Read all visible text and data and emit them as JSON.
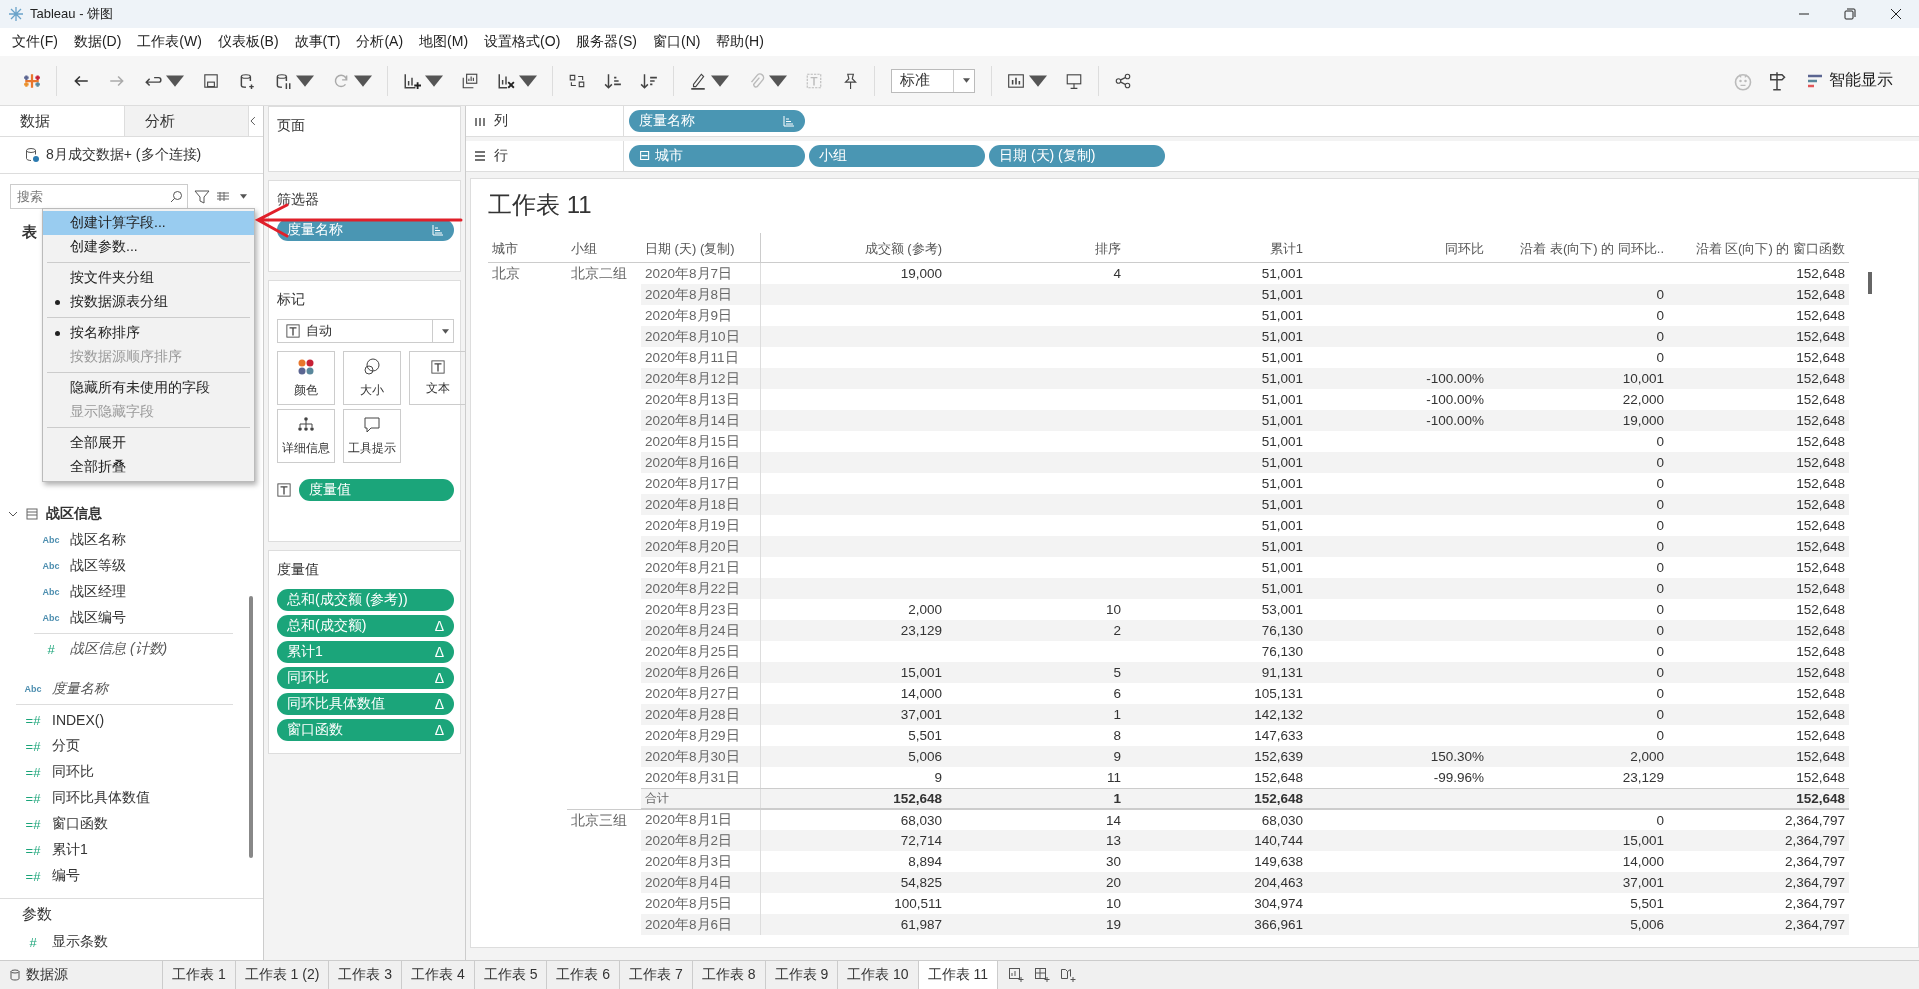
{
  "window": {
    "title": "Tableau - 饼图"
  },
  "menu_bar": [
    "文件(F)",
    "数据(D)",
    "工作表(W)",
    "仪表板(B)",
    "故事(T)",
    "分析(A)",
    "地图(M)",
    "设置格式(O)",
    "服务器(S)",
    "窗口(N)",
    "帮助(H)"
  ],
  "toolbar": {
    "view_size": "标准",
    "show_me": "智能显示"
  },
  "data_pane": {
    "tabs": [
      {
        "label": "数据",
        "selected": true
      },
      {
        "label": "分析",
        "selected": false
      }
    ],
    "data_source": "8月成交数据+ (多个连接)",
    "search": {
      "placeholder": "搜索"
    },
    "tables_heading": "表",
    "groups": [
      {
        "name": "战区信息",
        "expanded": true,
        "fields": [
          {
            "name": "战区名称",
            "icon": "Abc",
            "kind": "dimension"
          },
          {
            "name": "战区等级",
            "icon": "Abc",
            "kind": "dimension"
          },
          {
            "name": "战区经理",
            "icon": "Abc",
            "kind": "dimension"
          },
          {
            "name": "战区编号",
            "icon": "Abc",
            "kind": "dimension"
          },
          {
            "name": "战区信息 (计数)",
            "icon": "#",
            "kind": "generated_measure"
          }
        ]
      }
    ],
    "fields": [
      {
        "name": "度量名称",
        "icon": "Abc",
        "kind": "generated_dimension"
      },
      {
        "name": "INDEX()",
        "icon": "=#",
        "kind": "calc_measure"
      },
      {
        "name": "分页",
        "icon": "=#",
        "kind": "calc_measure"
      },
      {
        "name": "同环比",
        "icon": "=#",
        "kind": "calc_measure"
      },
      {
        "name": "同环比具体数值",
        "icon": "=#",
        "kind": "calc_measure"
      },
      {
        "name": "窗口函数",
        "icon": "=#",
        "kind": "calc_measure"
      },
      {
        "name": "累计1",
        "icon": "=#",
        "kind": "calc_measure"
      },
      {
        "name": "编号",
        "icon": "=#",
        "kind": "calc_measure"
      }
    ],
    "parameters_heading": "参数",
    "parameters": [
      {
        "name": "显示条数",
        "icon": "#"
      }
    ]
  },
  "context_menu": [
    {
      "kind": "item",
      "label": "创建计算字段...",
      "selected": true,
      "checked": false,
      "disabled": false
    },
    {
      "kind": "item",
      "label": "创建参数...",
      "selected": false,
      "checked": false,
      "disabled": false
    },
    {
      "kind": "separator"
    },
    {
      "kind": "item",
      "label": "按文件夹分组",
      "selected": false,
      "checked": false,
      "disabled": false
    },
    {
      "kind": "item",
      "label": "按数据源表分组",
      "selected": false,
      "checked": true,
      "disabled": false
    },
    {
      "kind": "separator"
    },
    {
      "kind": "item",
      "label": "按名称排序",
      "selected": false,
      "checked": true,
      "disabled": false
    },
    {
      "kind": "item",
      "label": "按数据源顺序排序",
      "selected": false,
      "checked": false,
      "disabled": true
    },
    {
      "kind": "separator"
    },
    {
      "kind": "item",
      "label": "隐藏所有未使用的字段",
      "selected": false,
      "checked": false,
      "disabled": false
    },
    {
      "kind": "item",
      "label": "显示隐藏字段",
      "selected": false,
      "checked": false,
      "disabled": true
    },
    {
      "kind": "separator"
    },
    {
      "kind": "item",
      "label": "全部展开",
      "selected": false,
      "checked": false,
      "disabled": false
    },
    {
      "kind": "item",
      "label": "全部折叠",
      "selected": false,
      "checked": false,
      "disabled": false
    }
  ],
  "pages_card": {
    "title": "页面"
  },
  "filters_card": {
    "title": "筛选器",
    "pills": [
      {
        "label": "度量名称",
        "kind": "dimension"
      }
    ]
  },
  "marks_card": {
    "title": "标记",
    "mark_type": "自动",
    "buttons": [
      {
        "label": "颜色",
        "kind": "color"
      },
      {
        "label": "大小",
        "kind": "size"
      },
      {
        "label": "文本",
        "kind": "text"
      },
      {
        "label": "详细信息",
        "kind": "detail"
      },
      {
        "label": "工具提示",
        "kind": "tooltip"
      }
    ],
    "pills": [
      {
        "label": "度量值",
        "kind": "text"
      }
    ]
  },
  "measure_values_card": {
    "title": "度量值",
    "pills": [
      {
        "label": "总和(成交额 (参考))"
      },
      {
        "label": "总和(成交额)",
        "flag": "Δ"
      },
      {
        "label": "累计1",
        "flag": "Δ"
      },
      {
        "label": "同环比",
        "flag": "Δ"
      },
      {
        "label": "同环比具体数值",
        "flag": "Δ"
      },
      {
        "label": "窗口函数",
        "flag": "Δ"
      }
    ]
  },
  "shelves": [
    {
      "kind": "columns",
      "label": "列",
      "pills": [
        {
          "label": "度量名称",
          "kind": "sorted"
        }
      ]
    },
    {
      "kind": "rows",
      "label": "行",
      "pills": [
        {
          "label": "城市",
          "prefix": "⊟",
          "kind": "plain"
        },
        {
          "label": "小组",
          "kind": "plain"
        },
        {
          "label": "日期 (天) (复制)",
          "kind": "plain"
        }
      ]
    }
  ],
  "sheet": {
    "title": "工作表 11",
    "columns": [
      "城市",
      "小组",
      "日期 (天) (复制)",
      "成交额 (参考)",
      "排序",
      "累计1",
      "同环比",
      "沿着 表(向下) 的 同环比..",
      "沿着 区(向下) 的 窗口函数"
    ],
    "cities": [
      {
        "name": "北京",
        "groups": [
          {
            "name": "北京二组",
            "rows": [
              {
                "kind": "data",
                "date": "2020年8月7日",
                "amount": "19,000",
                "rank": "4",
                "cumulative": "51,001",
                "window": "152,648"
              },
              {
                "kind": "data",
                "date": "2020年8月8日",
                "cumulative": "51,001",
                "ratio_detail": "0",
                "window": "152,648"
              },
              {
                "kind": "data",
                "date": "2020年8月9日",
                "cumulative": "51,001",
                "ratio_detail": "0",
                "window": "152,648"
              },
              {
                "kind": "data",
                "date": "2020年8月10日",
                "cumulative": "51,001",
                "ratio_detail": "0",
                "window": "152,648"
              },
              {
                "kind": "data",
                "date": "2020年8月11日",
                "cumulative": "51,001",
                "ratio_detail": "0",
                "window": "152,648"
              },
              {
                "kind": "data",
                "date": "2020年8月12日",
                "cumulative": "51,001",
                "ratio": "-100.00%",
                "ratio_detail": "10,001",
                "window": "152,648"
              },
              {
                "kind": "data",
                "date": "2020年8月13日",
                "cumulative": "51,001",
                "ratio": "-100.00%",
                "ratio_detail": "22,000",
                "window": "152,648"
              },
              {
                "kind": "data",
                "date": "2020年8月14日",
                "cumulative": "51,001",
                "ratio": "-100.00%",
                "ratio_detail": "19,000",
                "window": "152,648"
              },
              {
                "kind": "data",
                "date": "2020年8月15日",
                "cumulative": "51,001",
                "ratio_detail": "0",
                "window": "152,648"
              },
              {
                "kind": "data",
                "date": "2020年8月16日",
                "cumulative": "51,001",
                "ratio_detail": "0",
                "window": "152,648"
              },
              {
                "kind": "data",
                "date": "2020年8月17日",
                "cumulative": "51,001",
                "ratio_detail": "0",
                "window": "152,648"
              },
              {
                "kind": "data",
                "date": "2020年8月18日",
                "cumulative": "51,001",
                "ratio_detail": "0",
                "window": "152,648"
              },
              {
                "kind": "data",
                "date": "2020年8月19日",
                "cumulative": "51,001",
                "ratio_detail": "0",
                "window": "152,648"
              },
              {
                "kind": "data",
                "date": "2020年8月20日",
                "cumulative": "51,001",
                "ratio_detail": "0",
                "window": "152,648"
              },
              {
                "kind": "data",
                "date": "2020年8月21日",
                "cumulative": "51,001",
                "ratio_detail": "0",
                "window": "152,648"
              },
              {
                "kind": "data",
                "date": "2020年8月22日",
                "cumulative": "51,001",
                "ratio_detail": "0",
                "window": "152,648"
              },
              {
                "kind": "data",
                "date": "2020年8月23日",
                "amount": "2,000",
                "rank": "10",
                "cumulative": "53,001",
                "ratio_detail": "0",
                "window": "152,648"
              },
              {
                "kind": "data",
                "date": "2020年8月24日",
                "amount": "23,129",
                "rank": "2",
                "cumulative": "76,130",
                "ratio_detail": "0",
                "window": "152,648"
              },
              {
                "kind": "data",
                "date": "2020年8月25日",
                "cumulative": "76,130",
                "ratio_detail": "0",
                "window": "152,648"
              },
              {
                "kind": "data",
                "date": "2020年8月26日",
                "amount": "15,001",
                "rank": "5",
                "cumulative": "91,131",
                "ratio_detail": "0",
                "window": "152,648"
              },
              {
                "kind": "data",
                "date": "2020年8月27日",
                "amount": "14,000",
                "rank": "6",
                "cumulative": "105,131",
                "ratio_detail": "0",
                "window": "152,648"
              },
              {
                "kind": "data",
                "date": "2020年8月28日",
                "amount": "37,001",
                "rank": "1",
                "cumulative": "142,132",
                "ratio_detail": "0",
                "window": "152,648"
              },
              {
                "kind": "data",
                "date": "2020年8月29日",
                "amount": "5,501",
                "rank": "8",
                "cumulative": "147,633",
                "ratio_detail": "0",
                "window": "152,648"
              },
              {
                "kind": "data",
                "date": "2020年8月30日",
                "amount": "5,006",
                "rank": "9",
                "cumulative": "152,639",
                "ratio": "150.30%",
                "ratio_detail": "2,000",
                "window": "152,648"
              },
              {
                "kind": "data",
                "date": "2020年8月31日",
                "amount": "9",
                "rank": "11",
                "cumulative": "152,648",
                "ratio": "-99.96%",
                "ratio_detail": "23,129",
                "window": "152,648"
              },
              {
                "kind": "total",
                "date": "合计",
                "amount": "152,648",
                "rank": "1",
                "cumulative": "152,648",
                "window": "152,648"
              }
            ]
          },
          {
            "name": "北京三组",
            "rows": [
              {
                "kind": "data",
                "date": "2020年8月1日",
                "amount": "68,030",
                "rank": "14",
                "cumulative": "68,030",
                "ratio_detail": "0",
                "window": "2,364,797"
              },
              {
                "kind": "data",
                "date": "2020年8月2日",
                "amount": "72,714",
                "rank": "13",
                "cumulative": "140,744",
                "ratio_detail": "15,001",
                "window": "2,364,797"
              },
              {
                "kind": "data",
                "date": "2020年8月3日",
                "amount": "8,894",
                "rank": "30",
                "cumulative": "149,638",
                "ratio_detail": "14,000",
                "window": "2,364,797"
              },
              {
                "kind": "data",
                "date": "2020年8月4日",
                "amount": "54,825",
                "rank": "20",
                "cumulative": "204,463",
                "ratio_detail": "37,001",
                "window": "2,364,797"
              },
              {
                "kind": "data",
                "date": "2020年8月5日",
                "amount": "100,511",
                "rank": "10",
                "cumulative": "304,974",
                "ratio_detail": "5,501",
                "window": "2,364,797"
              },
              {
                "kind": "data",
                "date": "2020年8月6日",
                "amount": "61,987",
                "rank": "19",
                "cumulative": "366,961",
                "ratio_detail": "5,006",
                "window": "2,364,797"
              }
            ]
          }
        ]
      }
    ]
  },
  "sheet_tabs": [
    {
      "label": "数据源",
      "kind": "datasource",
      "selected": false
    },
    {
      "label": "工作表 1",
      "kind": "sheet",
      "selected": false
    },
    {
      "label": "工作表 1 (2)",
      "kind": "sheet",
      "selected": false
    },
    {
      "label": "工作表 3",
      "kind": "sheet",
      "selected": false
    },
    {
      "label": "工作表 4",
      "kind": "sheet",
      "selected": false
    },
    {
      "label": "工作表 5",
      "kind": "sheet",
      "selected": false
    },
    {
      "label": "工作表 6",
      "kind": "sheet",
      "selected": false
    },
    {
      "label": "工作表 7",
      "kind": "sheet",
      "selected": false
    },
    {
      "label": "工作表 8",
      "kind": "sheet",
      "selected": false
    },
    {
      "label": "工作表 9",
      "kind": "sheet",
      "selected": false
    },
    {
      "label": "工作表 10",
      "kind": "sheet",
      "selected": false
    },
    {
      "label": "工作表 11",
      "kind": "sheet",
      "selected": true
    }
  ]
}
